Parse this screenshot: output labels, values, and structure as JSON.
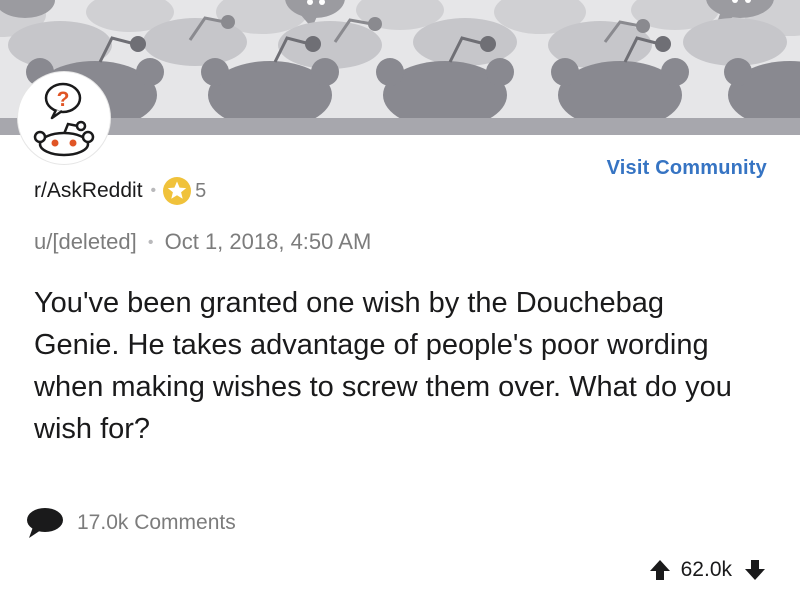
{
  "community": {
    "name": "r/AskReddit",
    "karma_badge_count": "5",
    "visit_label": "Visit Community"
  },
  "post": {
    "author": "u/[deleted]",
    "timestamp": "Oct 1, 2018, 4:50 AM",
    "title": "You've been granted one wish by the Douchebag Genie. He takes advantage of people's poor wording when making wishes to screw them over. What do you wish for?",
    "comments": "17.0k Comments",
    "score": "62.0k"
  },
  "icons": {
    "banner": "snoo-crowd-banner",
    "avatar": "askreddit-snoo-question-icon",
    "badge": "star-icon",
    "comments": "comment-bubble-icon",
    "upvote": "upvote-arrow-icon",
    "downvote": "downvote-arrow-icon"
  },
  "colors": {
    "link": "#3674c3",
    "meta": "#7c7c7c",
    "star": "#f0c23b",
    "question_mark": "#e05526"
  }
}
